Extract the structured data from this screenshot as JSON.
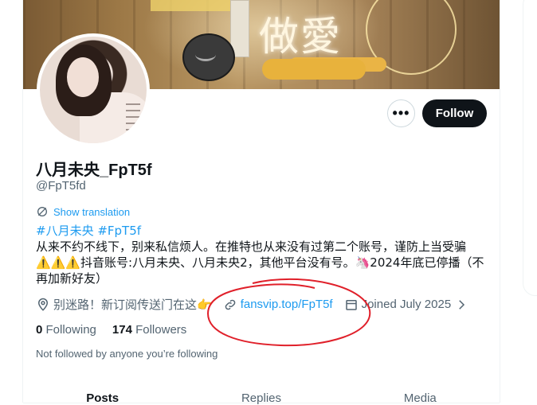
{
  "profile": {
    "display_name": "八月未央_FpT5f",
    "handle": "@FpT5fd",
    "show_translation": "Show translation",
    "bio_tags": "#八月未央 #FpT5f",
    "bio_text": "从来不约不线下，别来私信烦人。在推特也从来没有过第二个账号，谨防上当受骗⚠️⚠️⚠️抖音账号:八月未央、八月未央2，其他平台没有号。🦄2024年底已停播（不再加新好友）"
  },
  "actions": {
    "more_label": "•••",
    "follow_label": "Follow"
  },
  "meta": {
    "location": "别迷路！新订阅传送门在这👉",
    "link": "fansvip.top/FpT5f",
    "joined": "Joined July 2025"
  },
  "stats": {
    "following_count": "0",
    "following_label": "Following",
    "followers_count": "174",
    "followers_label": "Followers"
  },
  "not_followed": "Not followed by anyone you’re following",
  "tabs": [
    {
      "label": "Posts"
    },
    {
      "label": "Replies"
    },
    {
      "label": "Media"
    }
  ],
  "banner": {
    "text": "做愛"
  },
  "colors": {
    "accent": "#1d9bf0",
    "text_primary": "#0f1419",
    "text_secondary": "#536471",
    "annotation_red": "#e0202a"
  },
  "icons": {
    "translate": "translate-icon",
    "location": "location-pin-icon",
    "link": "link-icon",
    "calendar": "calendar-icon",
    "more": "more-horizontal-icon"
  }
}
